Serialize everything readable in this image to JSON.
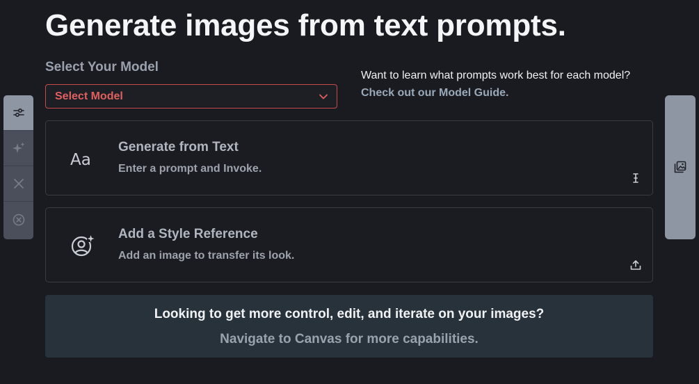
{
  "page": {
    "title": "Generate images from text prompts."
  },
  "model_section": {
    "label": "Select Your Model",
    "select_value": "Select Model"
  },
  "guide": {
    "text": "Want to learn what prompts work best for each model? ",
    "link": "Check out our Model Guide."
  },
  "cards": [
    {
      "title": "Generate from Text",
      "subtitle": "Enter a prompt and Invoke.",
      "icon": "text-aa-icon",
      "corner_icon": "text-cursor-icon"
    },
    {
      "title": "Add a Style Reference",
      "subtitle": "Add an image to transfer its look.",
      "icon": "user-sparkle-icon",
      "corner_icon": "upload-icon"
    }
  ],
  "canvas_banner": {
    "line1": "Looking to get more control, edit, and iterate on your images?",
    "line2": "Navigate to Canvas for more capabilities."
  },
  "left_toolbar": {
    "items": [
      {
        "icon": "sliders-icon",
        "active": true
      },
      {
        "icon": "sparkle-icon",
        "active": false
      },
      {
        "icon": "x-icon",
        "active": false
      },
      {
        "icon": "x-circle-icon",
        "active": false
      }
    ]
  },
  "right_toolbar": {
    "icon": "images-icon"
  },
  "colors": {
    "background": "#1a1b20",
    "error_red": "#e06060",
    "link": "#9aa9b9",
    "banner_bg": "#28323b",
    "toolbar_active": "#8f96a3"
  }
}
